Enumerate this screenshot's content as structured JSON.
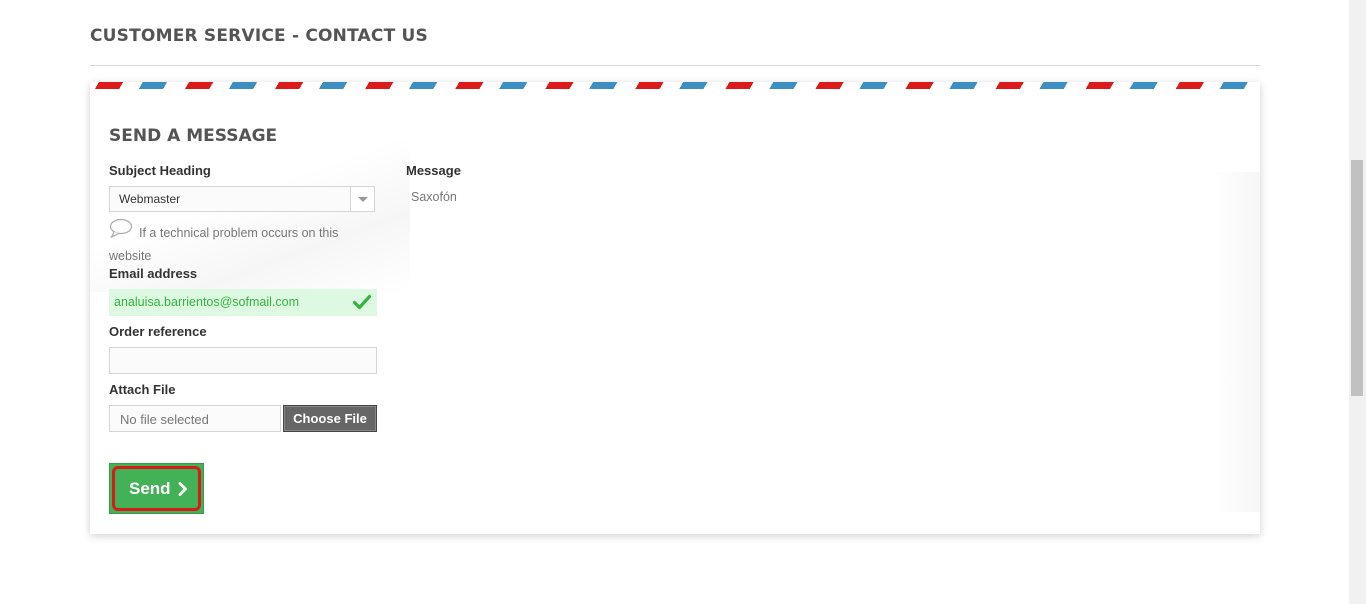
{
  "page": {
    "title": "CUSTOMER SERVICE - CONTACT US"
  },
  "form": {
    "heading": "SEND A MESSAGE",
    "subject": {
      "label": "Subject Heading",
      "selected": "Webmaster",
      "hint": "If a technical problem occurs on this website"
    },
    "email": {
      "label": "Email address",
      "value": "analuisa.barrientos@sofmail.com",
      "status": "valid"
    },
    "order_reference": {
      "label": "Order reference",
      "value": ""
    },
    "attach": {
      "label": "Attach File",
      "file_name": "No file selected",
      "button": "Choose File"
    },
    "message": {
      "label": "Message",
      "value": "Saxofón"
    },
    "send_label": "Send"
  },
  "colors": {
    "send_green": "#43b155",
    "valid_green": "#35b33f",
    "valid_bg": "#ddf9e1",
    "highlight_red": "#d91a1a",
    "airmail_blue": "#3d8fc2",
    "airmail_red": "#dd1a1a"
  },
  "icons": {
    "hint": "speech-bubble-icon",
    "email_valid": "check-icon",
    "send": "chevron-right-icon",
    "select": "chevron-down-icon"
  }
}
